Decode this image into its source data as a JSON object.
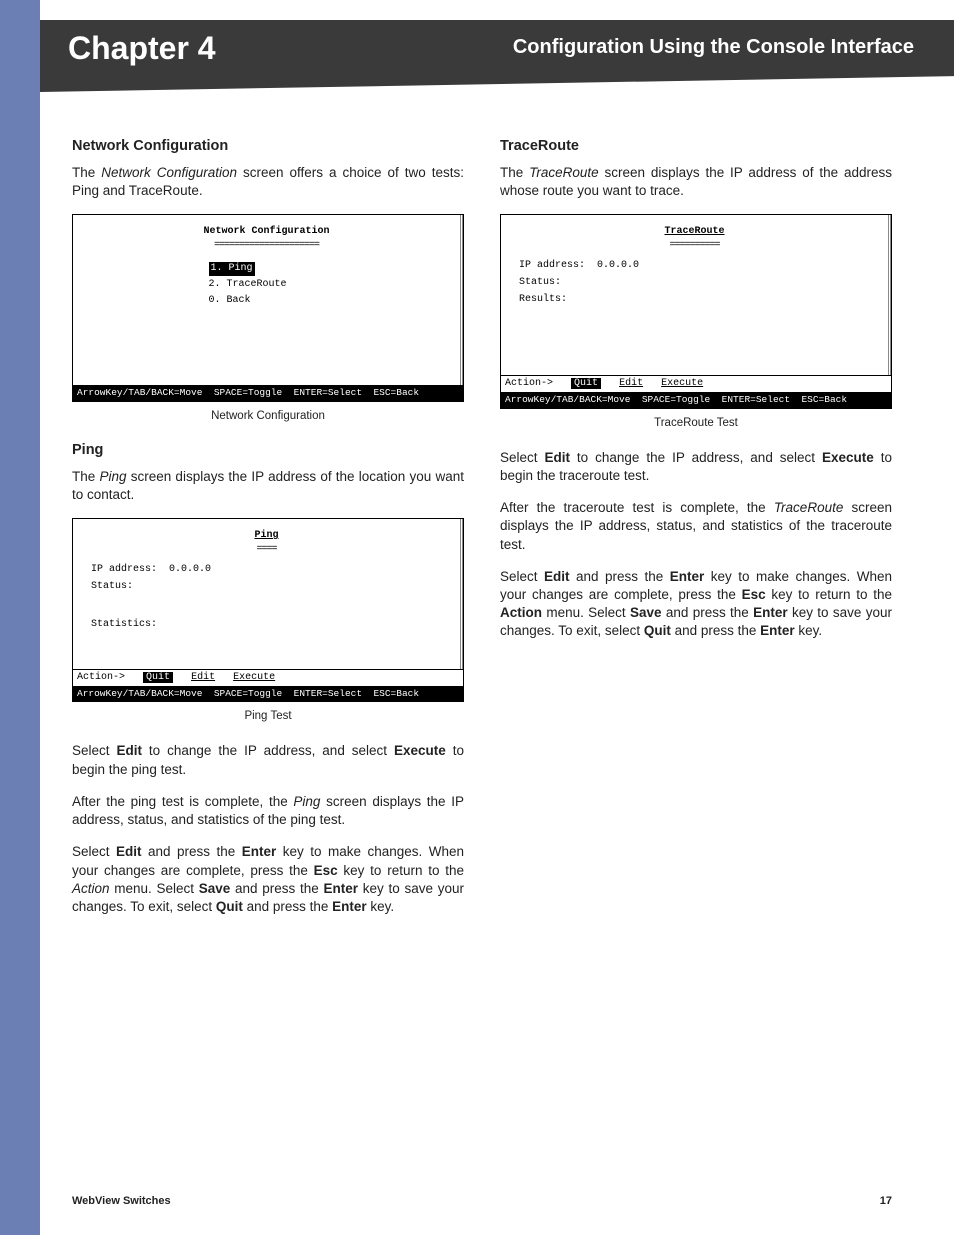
{
  "header": {
    "chapter": "Chapter 4",
    "title": "Configuration Using the Console Interface"
  },
  "left": {
    "h_netconf": "Network Configuration",
    "p_netconf": "The Network Configuration screen offers a choice of two tests: Ping and TraceRoute.",
    "console_netconf": {
      "title": "Network Configuration",
      "items": [
        "1. Ping",
        "2. TraceRoute",
        "0. Back"
      ],
      "selected_index": 0,
      "nav": "ArrowKey/TAB/BACK=Move  SPACE=Toggle  ENTER=Select  ESC=Back"
    },
    "cap_netconf": "Network Configuration",
    "h_ping": "Ping",
    "p_ping1": "The Ping screen displays the IP address of the location you want to contact.",
    "console_ping": {
      "title": "Ping",
      "ip_label": "IP address:",
      "ip_value": "0.0.0.0",
      "status_label": "Status:",
      "stats_label": "Statistics:",
      "action_label": "Action->",
      "actions": [
        "Quit",
        "Edit",
        "Execute"
      ],
      "selected_action_index": 0,
      "nav": "ArrowKey/TAB/BACK=Move  SPACE=Toggle  ENTER=Select  ESC=Back"
    },
    "cap_ping": "Ping Test",
    "p_ping2_a": "Select ",
    "p_ping2_b": "Edit",
    "p_ping2_c": " to change the IP address, and select ",
    "p_ping2_d": "Execute",
    "p_ping2_e": " to begin the ping test.",
    "p_ping3": "After the ping test is complete, the Ping screen displays the IP address, status, and statistics of the ping test.",
    "p_ping4": "Select Edit and press the Enter key to make changes. When your changes are complete, press the Esc key to return to the Action menu. Select Save and press the Enter key to save your changes. To exit, select Quit and press the Enter key."
  },
  "right": {
    "h_trace": "TraceRoute",
    "p_trace1": "The TraceRoute screen displays the IP address of the address whose route you want to trace.",
    "console_trace": {
      "title": "TraceRoute",
      "ip_label": "IP address:",
      "ip_value": "0.0.0.0",
      "status_label": "Status:",
      "results_label": "Results:",
      "action_label": "Action->",
      "actions": [
        "Quit",
        "Edit",
        "Execute"
      ],
      "selected_action_index": 0,
      "nav": "ArrowKey/TAB/BACK=Move  SPACE=Toggle  ENTER=Select  ESC=Back"
    },
    "cap_trace": "TraceRoute Test",
    "p_trace2_a": "Select ",
    "p_trace2_b": "Edit",
    "p_trace2_c": " to change the IP address, and select ",
    "p_trace2_d": "Execute",
    "p_trace2_e": " to begin the traceroute test.",
    "p_trace3": "After the traceroute test is complete, the TraceRoute screen displays the IP address, status, and statistics of the traceroute test.",
    "p_trace4": "Select Edit and press the Enter key to make changes. When your changes are complete, press the Esc key to return to the Action menu. Select Save and press the Enter key to save your changes. To exit, select Quit and press the Enter key."
  },
  "footer": {
    "left": "WebView Switches",
    "right": "17"
  }
}
